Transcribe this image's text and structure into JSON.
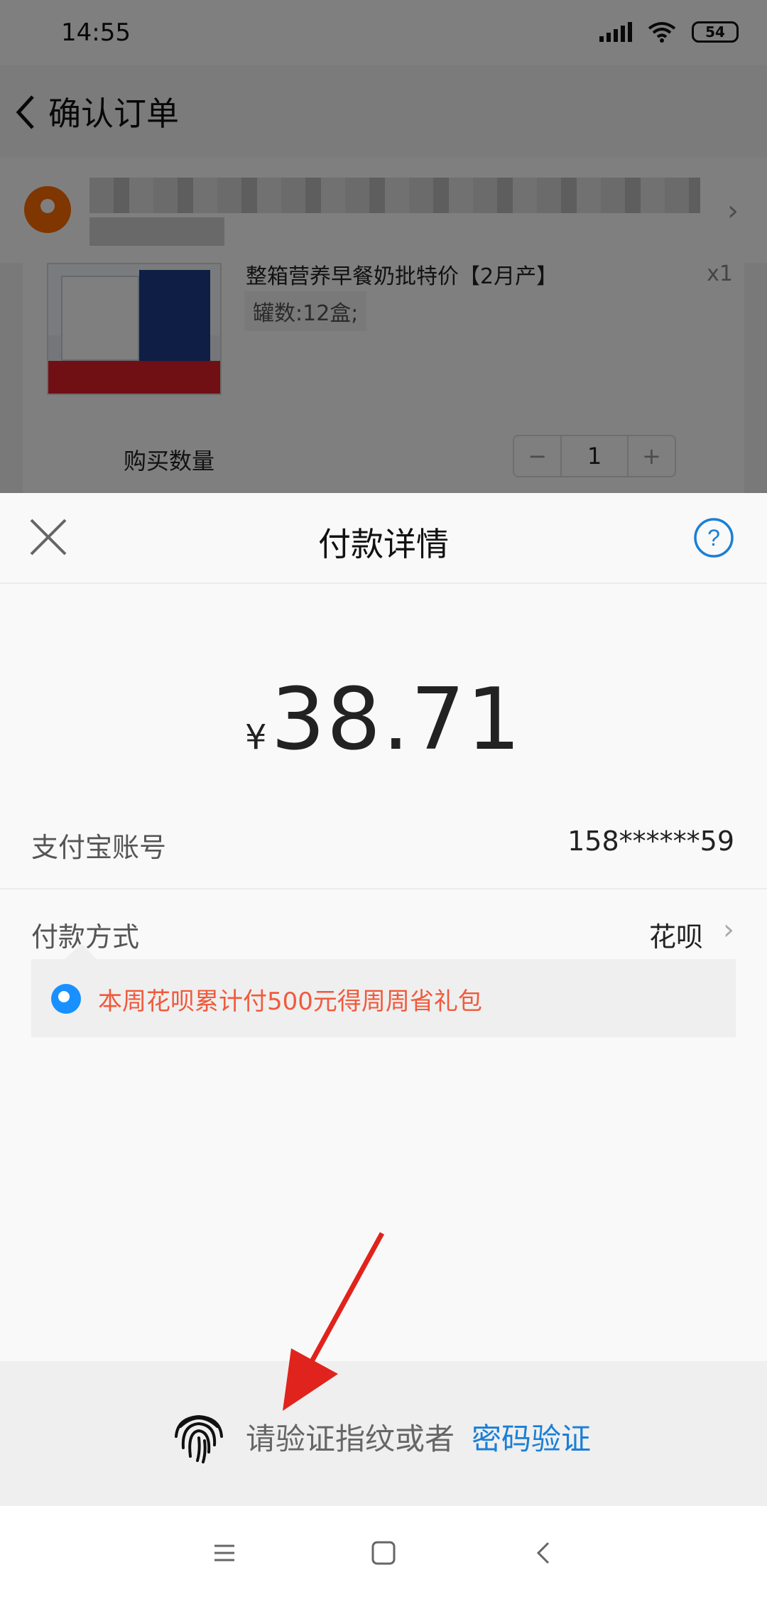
{
  "status_bar": {
    "time": "14:55",
    "battery": "54"
  },
  "order": {
    "title": "确认订单",
    "product_name": "整箱营养早餐奶批特价【2月产】",
    "product_spec": "罐数:12盒;",
    "product_qty": "x1",
    "buy_qty_label": "购买数量",
    "stepper": {
      "minus": "−",
      "value": "1",
      "plus": "+"
    }
  },
  "payment": {
    "title": "付款详情",
    "currency": "¥",
    "amount": "38.71",
    "account_label": "支付宝账号",
    "account_value": "158******59",
    "method_label": "付款方式",
    "method_value": "花呗",
    "promo_text": "本周花呗累计付500元得周周省礼包",
    "verify_prompt": "请验证指纹或者",
    "verify_link": "密码验证"
  },
  "colors": {
    "accent_blue": "#1a7fd6",
    "promo_red": "#f05a3c",
    "arrow_red": "#e0231c"
  },
  "icons": [
    "close-icon",
    "help-icon",
    "fingerprint-icon",
    "chevron-right-icon",
    "back-icon",
    "location-pin-icon",
    "menu-icon",
    "home-icon",
    "back-nav-icon"
  ]
}
